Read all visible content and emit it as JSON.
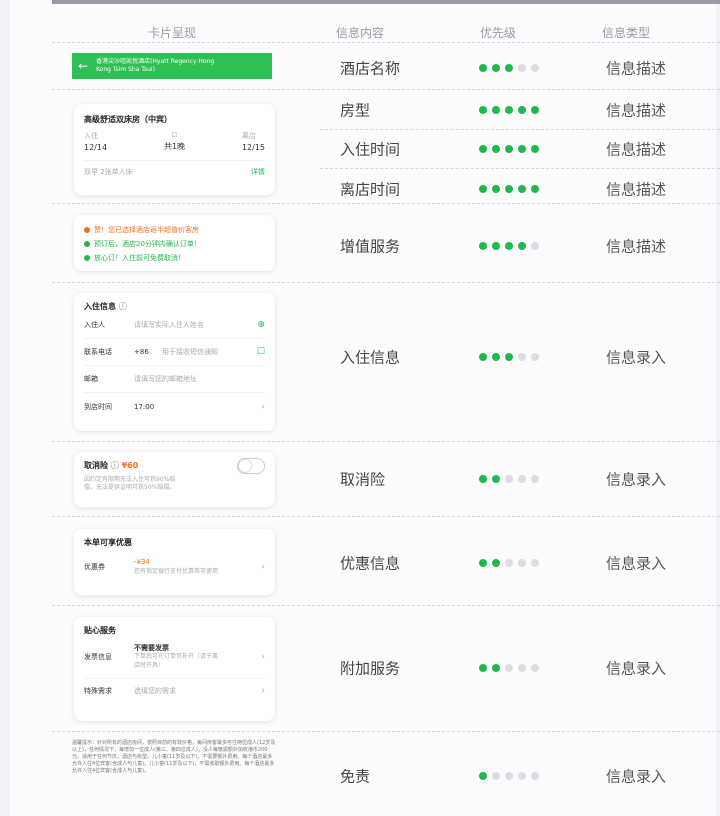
{
  "header": {
    "col_card": "卡片呈现",
    "col_info": "信息内容",
    "col_priority": "优先级",
    "col_type": "信息类型"
  },
  "rows": [
    {
      "info": "酒店名称",
      "priority": 3,
      "type": "信息描述"
    },
    {
      "info": "房型",
      "priority": 5,
      "type": "信息描述"
    },
    {
      "info": "入住时间",
      "priority": 5,
      "type": "信息描述"
    },
    {
      "info": "离店时间",
      "priority": 5,
      "type": "信息描述"
    },
    {
      "info": "增值服务",
      "priority": 4,
      "type": "信息描述"
    },
    {
      "info": "入住信息",
      "priority": 3,
      "type": "信息录入"
    },
    {
      "info": "取消险",
      "priority": 2,
      "type": "信息录入"
    },
    {
      "info": "优惠信息",
      "priority": 2,
      "type": "信息录入"
    },
    {
      "info": "附加服务",
      "priority": 2,
      "type": "信息录入"
    },
    {
      "info": "免责",
      "priority": 1,
      "type": "信息录入"
    }
  ],
  "hotel_bar": {
    "name_line1": "香港尖沙咀凯悦酒店(Hyatt Regency Hong",
    "name_line2": "Kong Tsim Sha Tsui)"
  },
  "room_card": {
    "title": "高级舒适双床房（中宾）",
    "checkin_label": "入住",
    "checkin_date": "12/14",
    "nights": "共1晚",
    "checkout_label": "离店",
    "checkout_date": "12/15",
    "detail": "双早  2张单人床",
    "detail_link": "详情"
  },
  "service_card": {
    "line1": "赞！您已选择酒店返半超值价客房",
    "line2": "预订后，酒店20分钟内确认订单！",
    "line3": "放心订！入住前可免费取消！"
  },
  "checkin_card": {
    "title": "入住信息",
    "guest_label": "入住人",
    "guest_placeholder": "请填写实际入住人姓名",
    "phone_label": "联系电话",
    "phone_code": "+86",
    "phone_placeholder": "用于接收短信通知",
    "email_label": "邮箱",
    "email_placeholder": "请填写您的邮箱地址",
    "arrival_label": "到店时间",
    "arrival_value": "17:00"
  },
  "insurance_card": {
    "title": "取消险",
    "price": "¥60",
    "desc_line1": "因约定有限期无法入住可获90%赔",
    "desc_line2": "偿，无法提供证明可获50%赔偿。"
  },
  "discount_card": {
    "title": "本单可享优惠",
    "coupon_label": "优惠券",
    "coupon_value": "-¥34",
    "coupon_desc": "您有指定银行支付优惠券可使用"
  },
  "extra_card": {
    "title": "贴心服务",
    "invoice_label": "发票信息",
    "invoice_value": "不需要发票",
    "invoice_desc_line1": "下单后可在订单页补开（请于离",
    "invoice_desc_line2": "店时开具）",
    "special_label": "特殊需求",
    "special_placeholder": "选填您的需求"
  },
  "notice": {
    "text": "温馨提示：针对所有的酒店房间，按照目前的有效价格，每间房客最多可住两位成人(12岁及以上)，任何情况下，每增加一位成人(第三、第四位成人)，没人每晚需额外加收港币200元。适用于任何节庆、酒店与房型。儿小童(11岁及以下)，不需要额外费用。每个酒店最多允许入住4位宾客(含成人与儿童)。儿小童(11岁及以下)，不需收取额外费用。每个酒店最多允许入住4位宾客(含成人与儿童)。"
  },
  "colors": {
    "accent_green": "#1fb84a",
    "bar_green": "#2fbf55",
    "orange": "#f07020",
    "dot_off": "#dcdce2"
  }
}
